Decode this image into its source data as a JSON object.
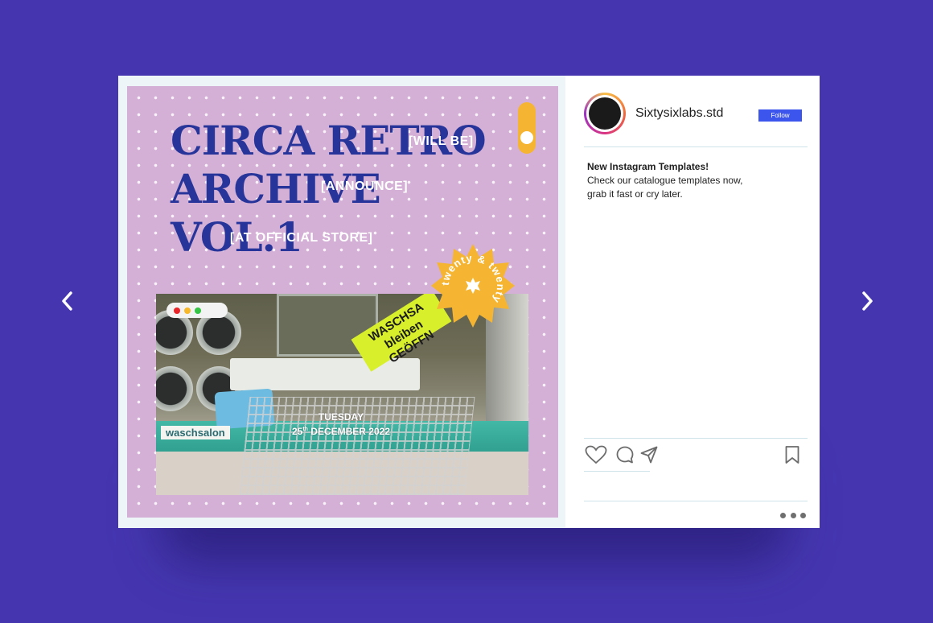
{
  "post": {
    "headline": [
      "CIRCA RETRO",
      "ARCHIVE",
      "VOL.1"
    ],
    "tags": {
      "will_be": "[WILL BE]",
      "announce": "[ANNOUNCE]",
      "official_store": "[AT OFFICIAL STORE]"
    },
    "badge_text": "twenty & twenty",
    "photo": {
      "sign_line1": "WASCHSA",
      "sign_line2": "bleiben GEÖFFN",
      "label": "waschsalon",
      "date_day": "TUESDAY",
      "date_num": "25",
      "date_sup": "th",
      "date_rest": "DECEMBER 2022"
    },
    "browser_dots": [
      "#e8262a",
      "#f6b72b",
      "#35c443"
    ]
  },
  "profile": {
    "username": "Sixtysixlabs.std",
    "follow_label": "Follow"
  },
  "caption": {
    "title": "New Instagram Templates!",
    "line1": "Check our catalogue templates now,",
    "line2": "grab it fast or cry later."
  },
  "icons": {
    "prev": "chevron-left-icon",
    "next": "chevron-right-icon",
    "like": "heart-icon",
    "comment": "comment-icon",
    "share": "send-icon",
    "save": "bookmark-icon",
    "more": "more-dots-icon"
  },
  "colors": {
    "background": "#4536b0",
    "headline": "#27359a",
    "post_bg": "#d4b0d6",
    "accent": "#f5b532",
    "follow": "#3c55ec"
  }
}
